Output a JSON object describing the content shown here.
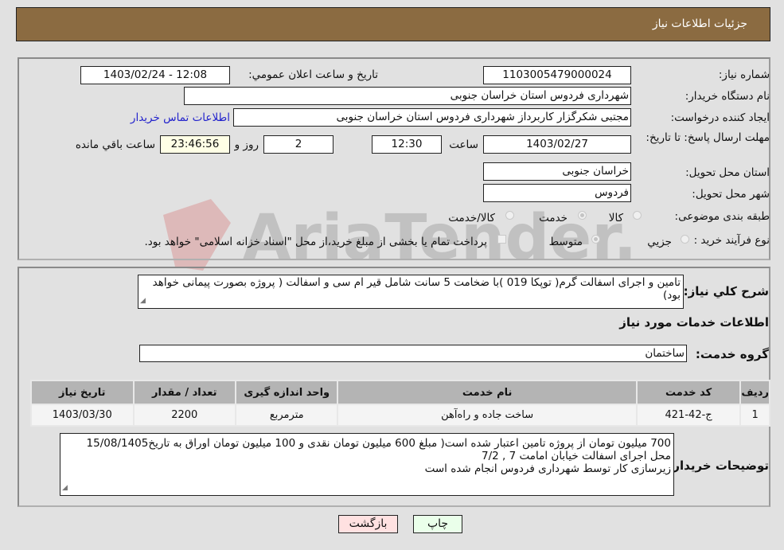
{
  "header": {
    "title": "جزئیات اطلاعات نیاز"
  },
  "form": {
    "need_number": {
      "label": "شماره نیاز:",
      "value": "1103005479000024"
    },
    "announce_datetime": {
      "label": "تاریخ و ساعت اعلان عمومي:",
      "value": "1403/02/24 - 12:08"
    },
    "buyer_org": {
      "label": "نام دستگاه خریدار:",
      "value": "شهرداری فردوس استان خراسان جنوبی"
    },
    "requester": {
      "label": "ایجاد کننده درخواست:",
      "value": "مجتبی شکرگزار کاربرداز شهرداری فردوس استان خراسان جنوبی"
    },
    "buyer_contact_link": "اطلاعات تماس خریدار",
    "deadline": {
      "label": "مهلت ارسال پاسخ: تا تاریخ:",
      "date": "1403/02/27",
      "time_label": "ساعت",
      "time": "12:30",
      "days": "2",
      "days_label": "روز و",
      "remaining": "23:46:56",
      "remaining_label": "ساعت باقي مانده"
    },
    "delivery_province": {
      "label": "استان محل تحویل:",
      "value": "خراسان جنوبی"
    },
    "delivery_city": {
      "label": "شهر محل تحویل:",
      "value": "فردوس"
    },
    "category": {
      "label": "طبقه بندی موضوعی:",
      "options": [
        "کالا",
        "خدمت",
        "کالا/خدمت"
      ],
      "selected": "خدمت"
    },
    "purchase_type": {
      "label": "نوع فرآیند خرید :",
      "options": [
        "جزيي",
        "متوسط"
      ],
      "selected": "متوسط",
      "treasury_checkbox_label": "پرداخت تمام یا بخشی از مبلغ خرید،از محل \"اسناد خزانه اسلامی\" خواهد بود.",
      "treasury_checked": false
    }
  },
  "description": {
    "label": "شرح كلي نياز:",
    "value": "تامین و اجرای اسفالت گرم( توپکا 019 )با ضخامت 5 سانت شامل قیر ام سی و اسفالت ( پروژه بصورت پیمانی خواهد بود)"
  },
  "services_section": {
    "title": "اطلاعات خدمات مورد نیاز",
    "group_label": "گروه خدمت:",
    "group_value": "ساختمان",
    "table": {
      "headers": [
        "ردیف",
        "کد خدمت",
        "نام خدمت",
        "واحد اندازه گیری",
        "تعداد / مقدار",
        "تاریخ نیاز"
      ],
      "rows": [
        [
          "1",
          "ج-42-421",
          "ساخت جاده و راه‌آهن",
          "مترمربع",
          "2200",
          "1403/03/30"
        ]
      ]
    }
  },
  "buyer_notes": {
    "label": "توضیحات خریدار:",
    "lines": [
      "700 میلیون تومان از پروژه تامین  اعتبار شده است( مبلغ 600 میلیون تومان نقدی و 100 میلیون تومان اوراق به تاریخ15/08/1405",
      " محل اجرای اسفالت خیابان امامت 7 , 7/2",
      "زیرسازی کار توسط شهرداری فردوس انجام شده است"
    ]
  },
  "buttons": {
    "print": "چاپ",
    "back": "بازگشت"
  },
  "colors": {
    "header_bg": "#8b6b41",
    "print_bg": "#eaffea",
    "back_bg": "#ffe1e1",
    "link": "#2222cc"
  },
  "watermark": {
    "text": "AriaTender.net"
  }
}
